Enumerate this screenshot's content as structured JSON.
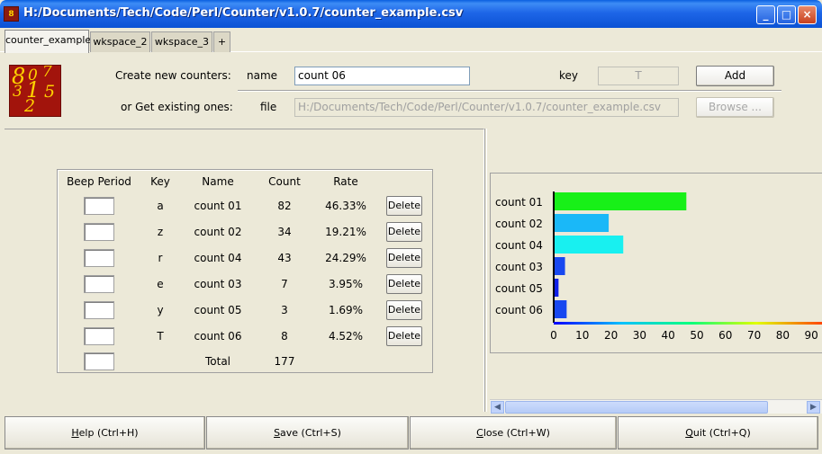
{
  "window": {
    "title": "H:/Documents/Tech/Code/Perl/Counter/v1.0.7/counter_example.csv",
    "icon_label": "8"
  },
  "tabs": [
    {
      "label": "counter_example",
      "active": true
    },
    {
      "label": "wkspace_2",
      "active": false
    },
    {
      "label": "wkspace_3",
      "active": false
    },
    {
      "label": "+",
      "active": false
    }
  ],
  "header": {
    "create_label": "Create new counters:",
    "name_label": "name",
    "name_value": "count 06",
    "key_label": "key",
    "key_value": "T",
    "add_label": "Add",
    "get_label": "or Get existing ones:",
    "file_label": "file",
    "file_value": "H:/Documents/Tech/Code/Perl/Counter/v1.0.7/counter_example.csv",
    "browse_label": "Browse ..."
  },
  "table": {
    "headers": {
      "beep": "Beep Period",
      "key": "Key",
      "name": "Name",
      "count": "Count",
      "rate": "Rate"
    },
    "delete_label": "Delete",
    "rows": [
      {
        "key": "a",
        "name": "count 01",
        "count": "82",
        "rate": "46.33%"
      },
      {
        "key": "z",
        "name": "count 02",
        "count": "34",
        "rate": "19.21%"
      },
      {
        "key": "r",
        "name": "count 04",
        "count": "43",
        "rate": "24.29%"
      },
      {
        "key": "e",
        "name": "count 03",
        "count": "7",
        "rate": "3.95%"
      },
      {
        "key": "y",
        "name": "count 05",
        "count": "3",
        "rate": "1.69%"
      },
      {
        "key": "T",
        "name": "count 06",
        "count": "8",
        "rate": "4.52%"
      }
    ],
    "total_label": "Total",
    "total_value": "177"
  },
  "chart_data": {
    "type": "bar",
    "orientation": "horizontal",
    "categories": [
      "count 01",
      "count 02",
      "count 04",
      "count 03",
      "count 05",
      "count 06"
    ],
    "values": [
      46.33,
      19.21,
      24.29,
      3.95,
      1.69,
      4.52
    ],
    "colors": [
      "#18f018",
      "#1ab8f8",
      "#18f0f0",
      "#1848f0",
      "#1020e8",
      "#1848f0"
    ],
    "xticks": [
      "0",
      "10",
      "20",
      "30",
      "40",
      "50",
      "60",
      "70",
      "80",
      "90"
    ],
    "xlim": [
      0,
      90
    ],
    "grid": false
  },
  "buttons": {
    "help": {
      "hot": "H",
      "rest": "elp (Ctrl+H)"
    },
    "save": {
      "hot": "S",
      "rest": "ave (Ctrl+S)"
    },
    "close": {
      "hot": "C",
      "rest": "lose (Ctrl+W)"
    },
    "quit": {
      "hot": "Q",
      "rest": "uit (Ctrl+Q)"
    }
  }
}
